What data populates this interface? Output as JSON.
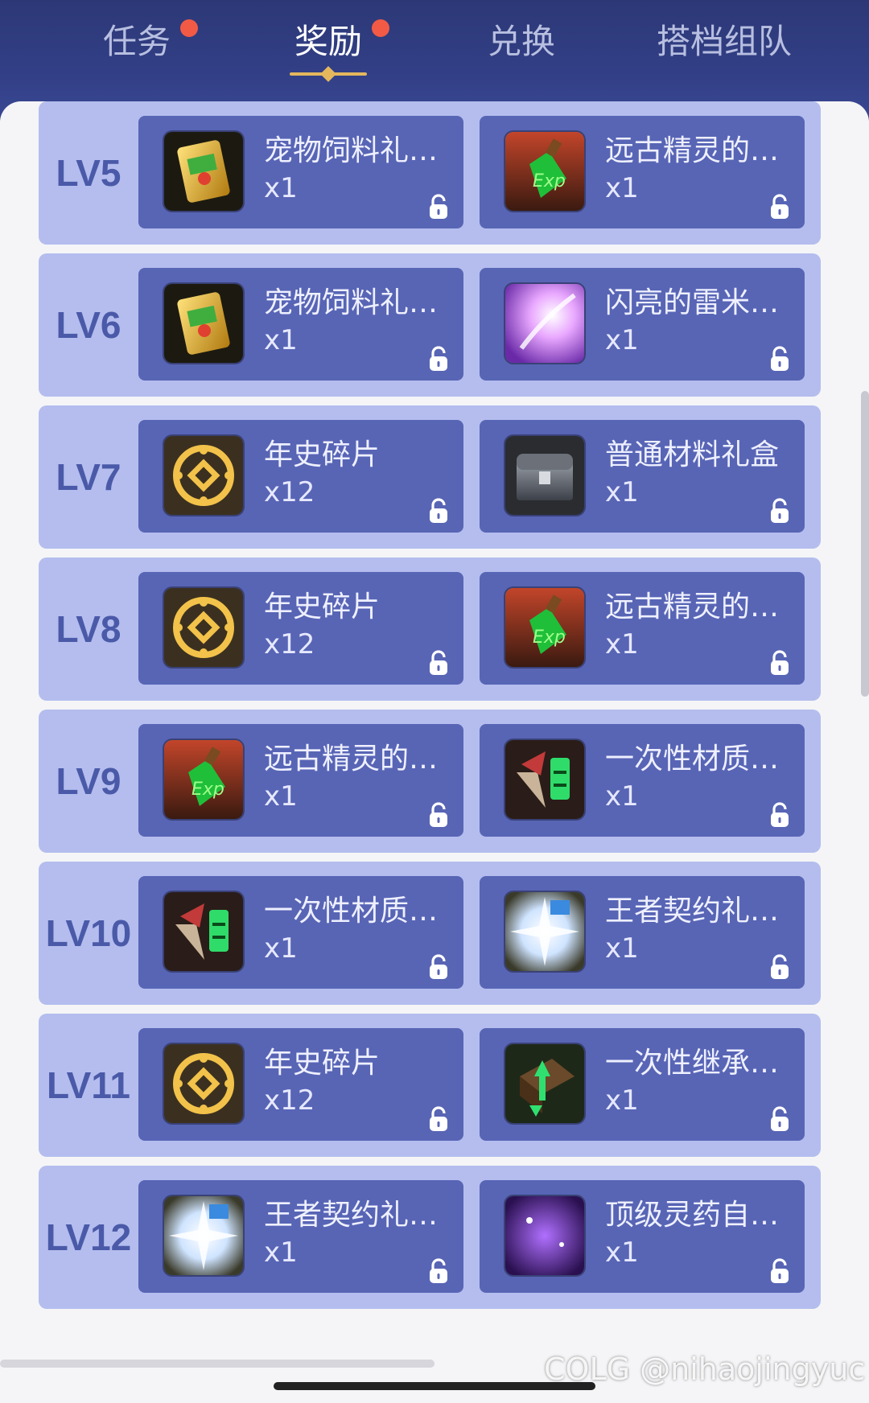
{
  "tabs": [
    {
      "label": "任务",
      "has_dot": true
    },
    {
      "label": "奖励",
      "has_dot": true,
      "active": true
    },
    {
      "label": "兑换",
      "has_dot": false
    },
    {
      "label": "搭档组队",
      "has_dot": false
    }
  ],
  "rewards": [
    {
      "level": "LV5",
      "items": [
        {
          "name": "宠物饲料礼袋 ...",
          "qty": "x1",
          "icon": "pet-food-bag-icon"
        },
        {
          "name": "远古精灵的秘...",
          "qty": "x1",
          "icon": "exp-potion-icon"
        }
      ]
    },
    {
      "level": "LV6",
      "items": [
        {
          "name": "宠物饲料礼袋 ...",
          "qty": "x1",
          "icon": "pet-food-bag-icon"
        },
        {
          "name": "闪亮的雷米援...",
          "qty": "x1",
          "icon": "sparkle-icon"
        }
      ]
    },
    {
      "level": "LV7",
      "items": [
        {
          "name": "年史碎片",
          "qty": "x12",
          "icon": "coin-fragment-icon"
        },
        {
          "name": "普通材料礼盒",
          "qty": "x1",
          "icon": "chest-icon"
        }
      ]
    },
    {
      "level": "LV8",
      "items": [
        {
          "name": "年史碎片",
          "qty": "x12",
          "icon": "coin-fragment-icon"
        },
        {
          "name": "远古精灵的秘...",
          "qty": "x1",
          "icon": "exp-potion-icon"
        }
      ]
    },
    {
      "level": "LV9",
      "items": [
        {
          "name": "远古精灵的秘...",
          "qty": "x1",
          "icon": "exp-potion-icon"
        },
        {
          "name": "一次性材质转...",
          "qty": "x1",
          "icon": "material-convert-icon"
        }
      ]
    },
    {
      "level": "LV10",
      "items": [
        {
          "name": "一次性材质转...",
          "qty": "x1",
          "icon": "material-convert-icon"
        },
        {
          "name": "王者契约礼包...",
          "qty": "x1",
          "icon": "contract-pack-icon"
        }
      ]
    },
    {
      "level": "LV11",
      "items": [
        {
          "name": "年史碎片",
          "qty": "x12",
          "icon": "coin-fragment-icon"
        },
        {
          "name": "一次性继承装...",
          "qty": "x1",
          "icon": "inherit-equip-icon"
        }
      ]
    },
    {
      "level": "LV12",
      "items": [
        {
          "name": "王者契约礼包...",
          "qty": "x1",
          "icon": "contract-pack-icon"
        },
        {
          "name": "顶级灵药自选...",
          "qty": "x1",
          "icon": "elixir-icon"
        }
      ]
    }
  ],
  "watermark": "COLG @nihaojingyuc",
  "colors": {
    "header": "#323f86",
    "row_bg": "#b4bdee",
    "card_bg": "#5865b5",
    "level_text": "#4a5aa8",
    "badge_dot": "#f25a45",
    "tab_underline": "#e4b75d"
  }
}
